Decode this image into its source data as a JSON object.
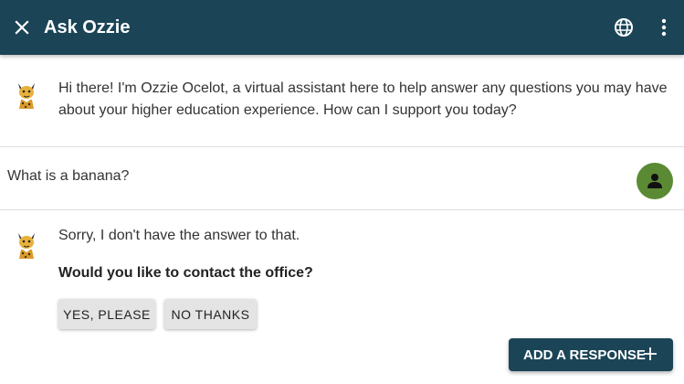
{
  "header": {
    "title": "Ask Ozzie",
    "close_icon": "close-icon",
    "language_icon": "globe-icon",
    "menu_icon": "more-vert-icon",
    "background_color": "#1b4557"
  },
  "conversation": {
    "greeting": "Hi there! I'm Ozzie Ocelot, a virtual assistant here to help answer any questions you may have about your higher education experience. How can I support you today?",
    "user_message": "What is a banana?",
    "bot_answer": "Sorry, I don't have the answer to that.",
    "bot_question": "Would you like to contact the office?",
    "choices": [
      "YES, PLEASE",
      "NO THANKS"
    ],
    "user_avatar_color": "#5b8a35"
  },
  "footer": {
    "add_response_label": "ADD A RESPONSE",
    "add_icon": "plus-icon"
  }
}
